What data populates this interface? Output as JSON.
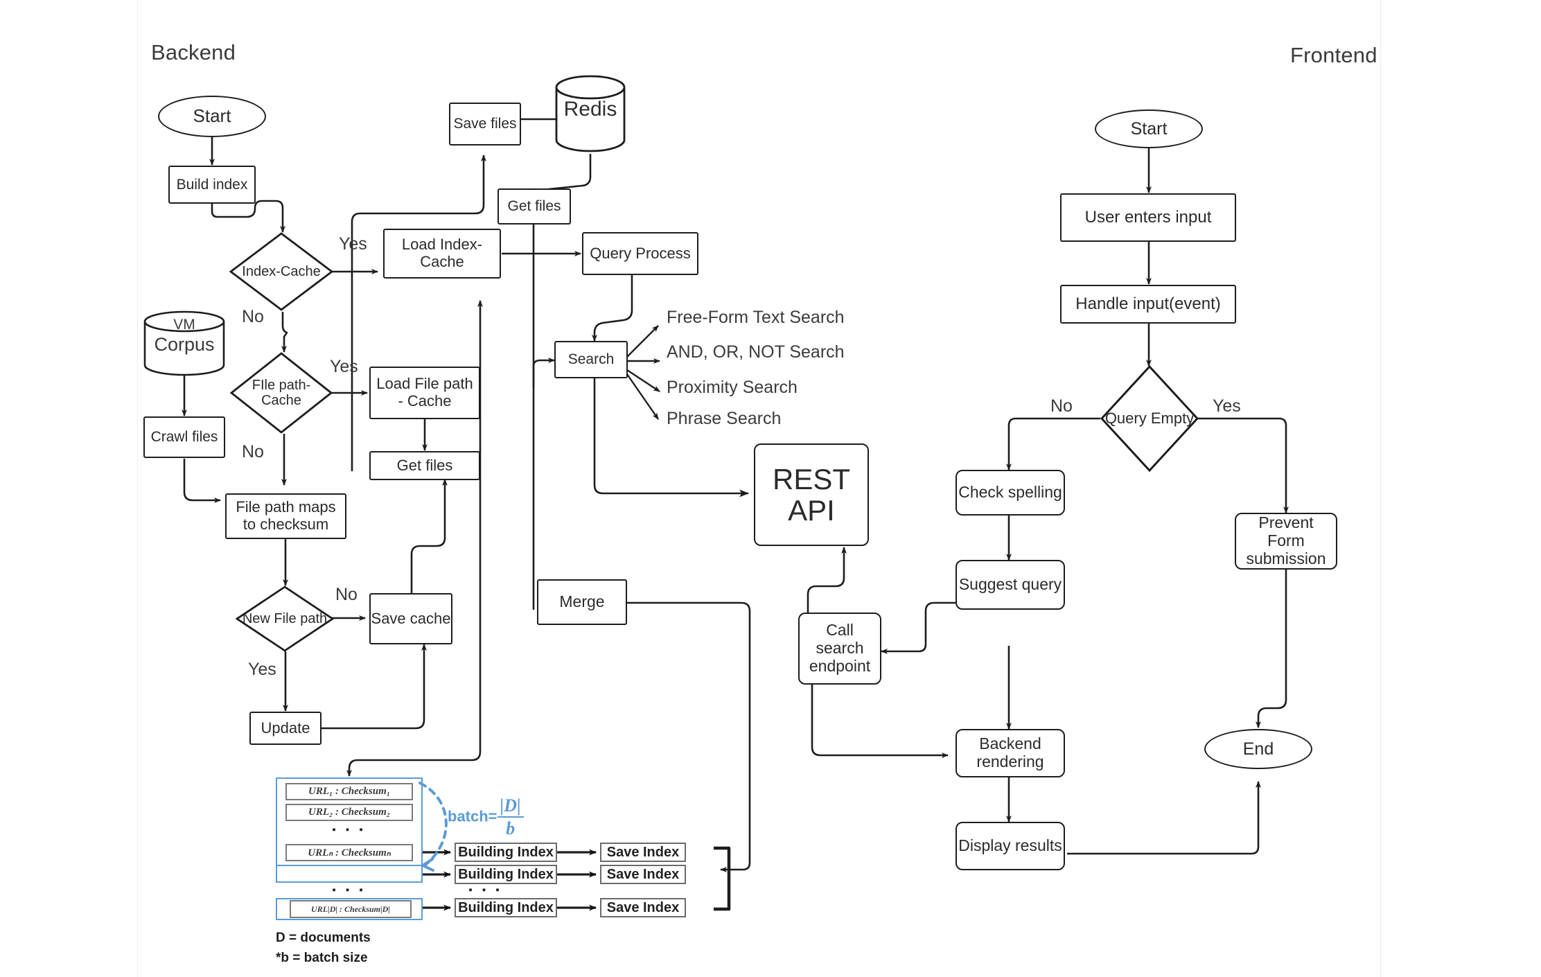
{
  "sections": {
    "backend_title": "Backend",
    "frontend_title": "Frontend"
  },
  "backend": {
    "start": "Start",
    "build_index": "Build index",
    "index_cache": "Index-Cache",
    "index_cache_yes": "Yes",
    "index_cache_no": "No",
    "load_index_cache": "Load Index-Cache",
    "vm_label": "VM",
    "corpus": "Corpus",
    "crawl_files": "Crawl files",
    "file_path_cache": "FIle path-Cache",
    "file_path_cache_yes": "Yes",
    "file_path_cache_no": "No",
    "load_file_path_cache": "Load File path - Cache",
    "get_files_left": "Get files",
    "file_path_maps": "File path maps to checksum",
    "new_file_path": "New File path",
    "new_file_path_no": "No",
    "new_file_path_yes": "Yes",
    "save_cache": "Save cache",
    "update": "Update",
    "save_files": "Save files",
    "redis": "Redis",
    "get_files_top": "Get files",
    "query_process": "Query Process",
    "search": "Search",
    "merge": "Merge",
    "rest_api": "REST API",
    "search_modes": [
      "Free-Form Text Search",
      "AND, OR, NOT Search",
      "Proximity Search",
      "Phrase Search"
    ]
  },
  "batch": {
    "rows": [
      "URL₁ : Checksum₁",
      "URL₂ : Checksum₂",
      "URLₙ : Checksumₙ"
    ],
    "row_last": "URL|D| : Checksum|D|",
    "ellipsis": "▪ ▪ ▪",
    "batch_label": "batch=",
    "batch_numerator": "|D|",
    "batch_denominator": "b",
    "building_index": "Building Index",
    "save_index": "Save Index",
    "legend_line1": "D = documents",
    "legend_line2": "*b = batch size"
  },
  "frontend": {
    "start": "Start",
    "user_enters_input": "User enters input",
    "handle_input": "Handle input(event)",
    "query_empty": "Query Empty",
    "query_empty_no": "No",
    "query_empty_yes": "Yes",
    "check_spelling": "Check spelling",
    "suggest_query": "Suggest query",
    "call_search_endpoint": "Call search endpoint",
    "prevent_form_submission": "Prevent Form submission",
    "backend_rendering": "Backend rendering",
    "display_results": "Display results",
    "end": "End"
  },
  "colors": {
    "stroke": "#1d1d1d",
    "text": "#3b3b3b",
    "accent_blue": "#5b9bd5",
    "grey_box": "#7a7a7a",
    "divider": "#eceded"
  }
}
